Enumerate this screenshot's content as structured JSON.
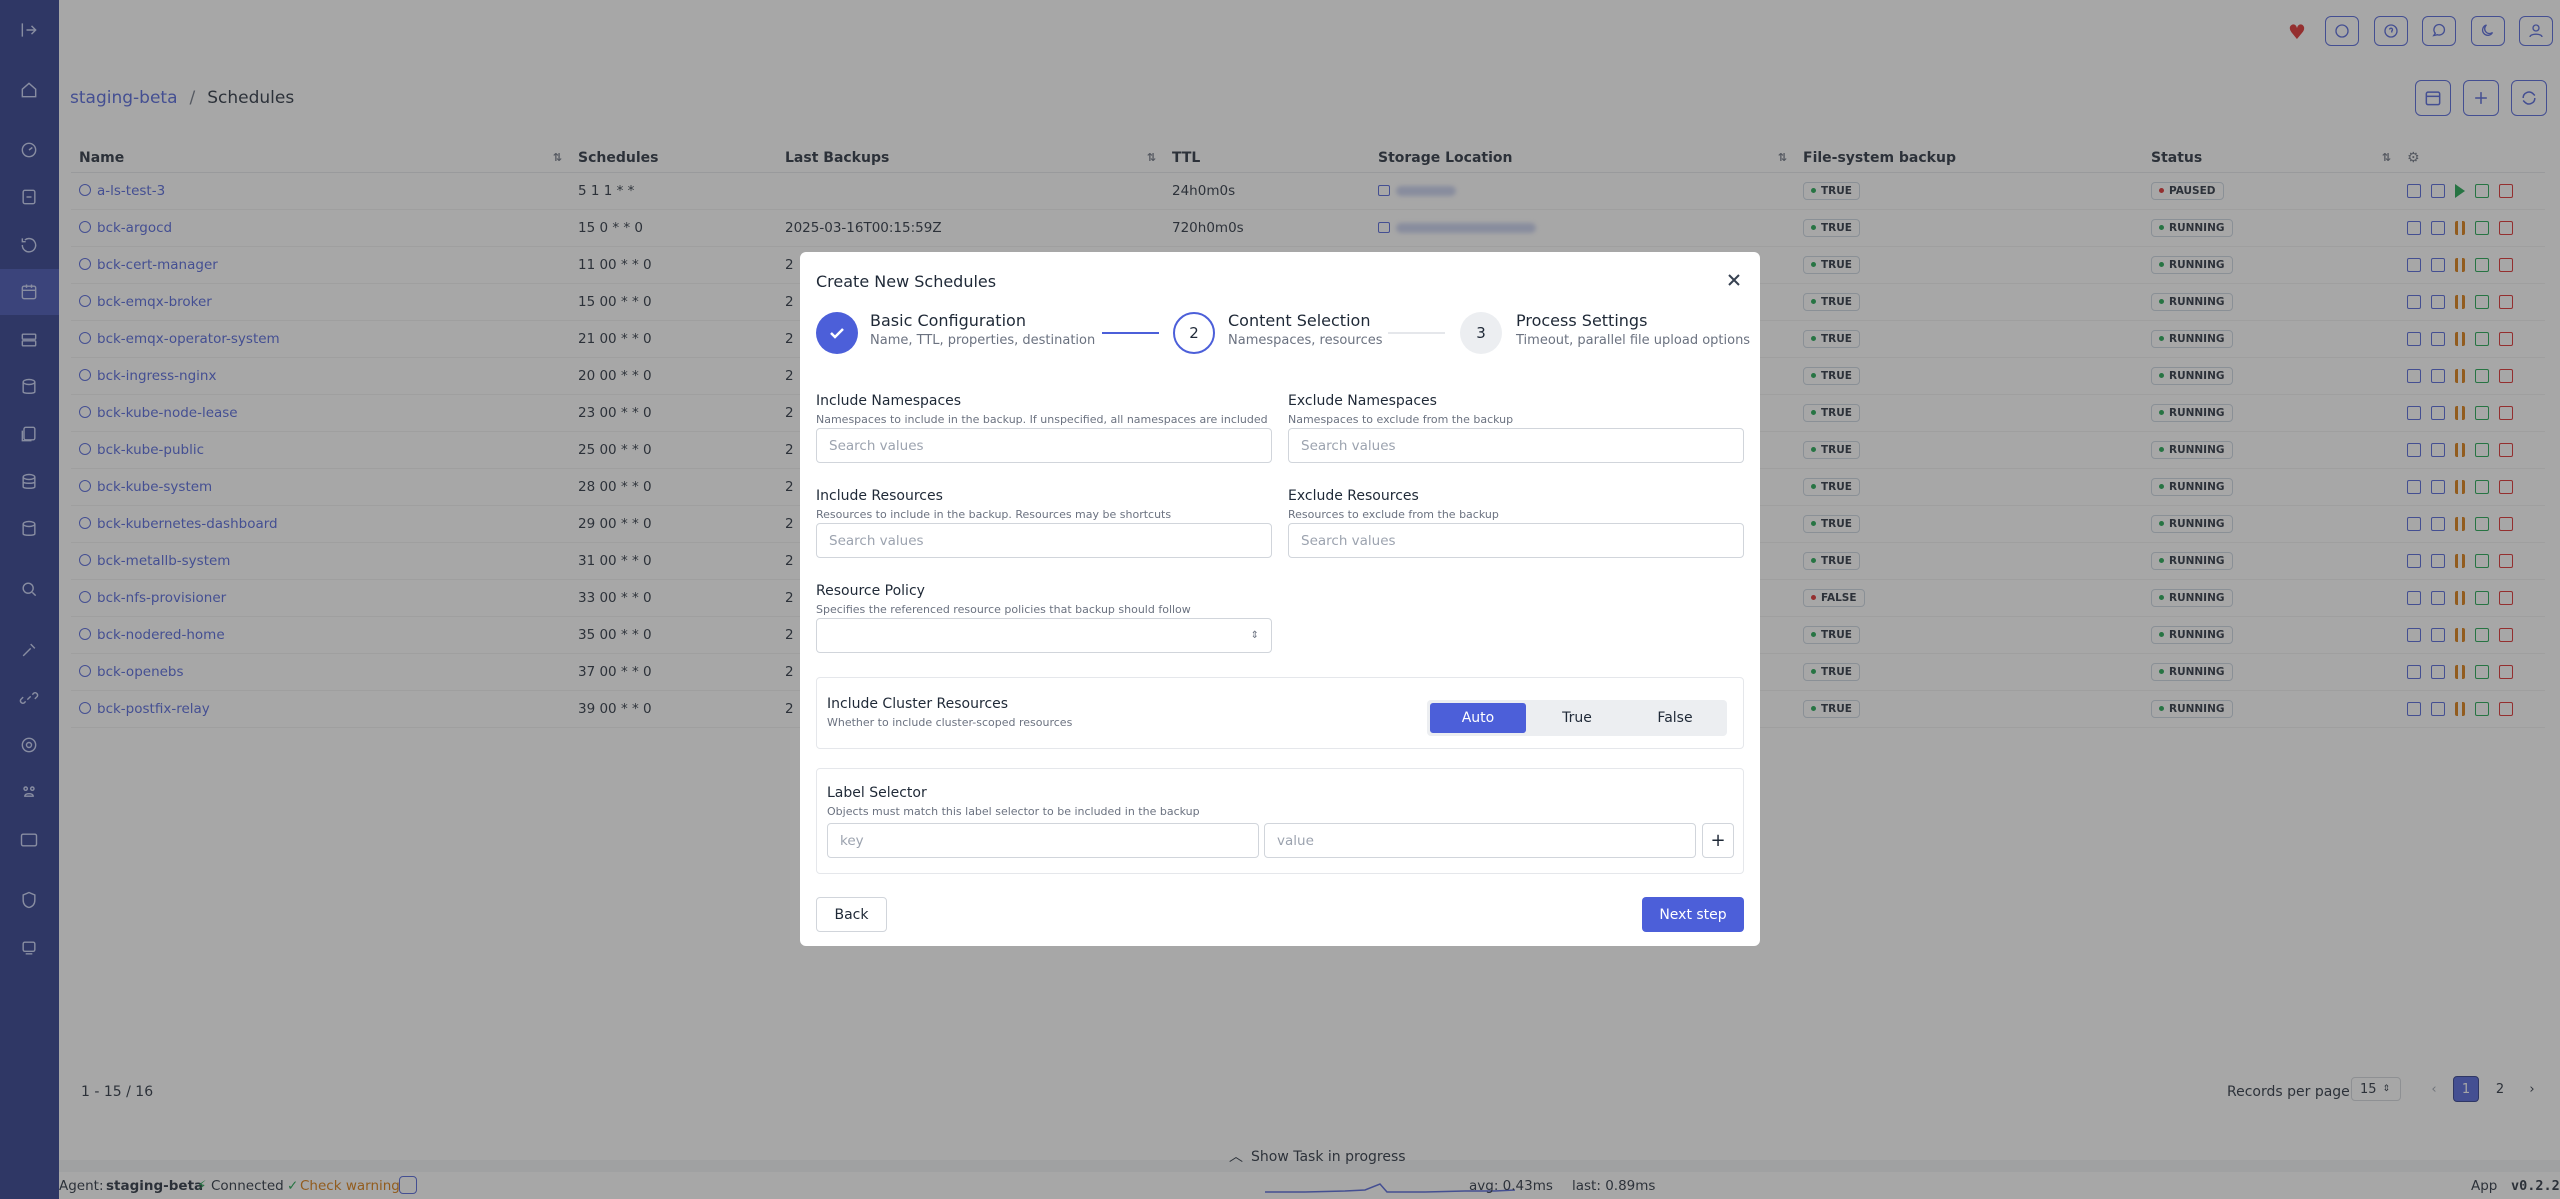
{
  "breadcrumb": {
    "cluster": "staging-beta",
    "separator": "/",
    "page": "Schedules"
  },
  "table": {
    "columns": [
      "Name",
      "Schedules",
      "Last Backups",
      "TTL",
      "Storage Location",
      "File-system backup",
      "Status"
    ],
    "rows": [
      {
        "name": "a-ls-test-3",
        "schedule": "5 1 1 * *",
        "last": "",
        "ttl": "24h0m0s",
        "fs": "TRUE",
        "status": "PAUSED"
      },
      {
        "name": "bck-argocd",
        "schedule": "15 0 * * 0",
        "last": "2025-03-16T00:15:59Z",
        "ttl": "720h0m0s",
        "fs": "TRUE",
        "status": "RUNNING"
      },
      {
        "name": "bck-cert-manager",
        "schedule": "11 00 * * 0",
        "last": "2",
        "ttl": "",
        "fs": "TRUE",
        "status": "RUNNING"
      },
      {
        "name": "bck-emqx-broker",
        "schedule": "15 00 * * 0",
        "last": "2",
        "ttl": "",
        "fs": "TRUE",
        "status": "RUNNING"
      },
      {
        "name": "bck-emqx-operator-system",
        "schedule": "21 00 * * 0",
        "last": "2",
        "ttl": "",
        "fs": "TRUE",
        "status": "RUNNING"
      },
      {
        "name": "bck-ingress-nginx",
        "schedule": "20 00 * * 0",
        "last": "2",
        "ttl": "",
        "fs": "TRUE",
        "status": "RUNNING"
      },
      {
        "name": "bck-kube-node-lease",
        "schedule": "23 00 * * 0",
        "last": "2",
        "ttl": "",
        "fs": "TRUE",
        "status": "RUNNING"
      },
      {
        "name": "bck-kube-public",
        "schedule": "25 00 * * 0",
        "last": "2",
        "ttl": "",
        "fs": "TRUE",
        "status": "RUNNING"
      },
      {
        "name": "bck-kube-system",
        "schedule": "28 00 * * 0",
        "last": "2",
        "ttl": "",
        "fs": "TRUE",
        "status": "RUNNING"
      },
      {
        "name": "bck-kubernetes-dashboard",
        "schedule": "29 00 * * 0",
        "last": "2",
        "ttl": "",
        "fs": "TRUE",
        "status": "RUNNING"
      },
      {
        "name": "bck-metallb-system",
        "schedule": "31 00 * * 0",
        "last": "2",
        "ttl": "",
        "fs": "TRUE",
        "status": "RUNNING"
      },
      {
        "name": "bck-nfs-provisioner",
        "schedule": "33 00 * * 0",
        "last": "2",
        "ttl": "",
        "fs": "FALSE",
        "status": "RUNNING"
      },
      {
        "name": "bck-nodered-home",
        "schedule": "35 00 * * 0",
        "last": "2",
        "ttl": "",
        "fs": "TRUE",
        "status": "RUNNING"
      },
      {
        "name": "bck-openebs",
        "schedule": "37 00 * * 0",
        "last": "2",
        "ttl": "",
        "fs": "TRUE",
        "status": "RUNNING"
      },
      {
        "name": "bck-postfix-relay",
        "schedule": "39 00 * * 0",
        "last": "2",
        "ttl": "",
        "fs": "TRUE",
        "status": "RUNNING"
      }
    ]
  },
  "footer": {
    "range": "1 - 15 / 16",
    "records_label": "Records per page",
    "records_value": "15",
    "pages": [
      "1",
      "2"
    ],
    "current_page": "1",
    "show_task": "Show Task in progress"
  },
  "statusbar": {
    "agent_label": "Agent:",
    "agent_name": "staging-beta",
    "connected": "Connected",
    "warning": "Check warning",
    "avg": "avg: 0.43ms",
    "last": "last: 0.89ms",
    "app": "App",
    "version": "v0.2.2"
  },
  "modal": {
    "title": "Create New Schedules",
    "steps": [
      {
        "number": "1",
        "title": "Basic Configuration",
        "subtitle": "Name, TTL, properties, destination"
      },
      {
        "number": "2",
        "title": "Content Selection",
        "subtitle": "Namespaces, resources"
      },
      {
        "number": "3",
        "title": "Process Settings",
        "subtitle": "Timeout, parallel file upload options"
      }
    ],
    "include_ns": {
      "label": "Include Namespaces",
      "help": "Namespaces to include in the backup. If unspecified, all namespaces are included",
      "placeholder": "Search values"
    },
    "exclude_ns": {
      "label": "Exclude Namespaces",
      "help": "Namespaces to exclude from the backup",
      "placeholder": "Search values"
    },
    "include_res": {
      "label": "Include Resources",
      "help": "Resources to include in the backup. Resources may be shortcuts",
      "placeholder": "Search values"
    },
    "exclude_res": {
      "label": "Exclude Resources",
      "help": "Resources to exclude from the backup",
      "placeholder": "Search values"
    },
    "policy": {
      "label": "Resource Policy",
      "help": "Specifies the referenced resource policies that backup should follow"
    },
    "cluster": {
      "label": "Include Cluster Resources",
      "help": "Whether to include cluster-scoped resources",
      "options": [
        "Auto",
        "True",
        "False"
      ],
      "selected": "Auto"
    },
    "label_selector": {
      "label": "Label Selector",
      "help": "Objects must match this label selector to be included in the backup",
      "key_placeholder": "key",
      "value_placeholder": "value"
    },
    "back": "Back",
    "next": "Next step"
  },
  "colors": {
    "accent": "#4c5fd9",
    "sidebar": "#253487",
    "paused": "#dc2626",
    "running": "#16a34a",
    "heart": "#dc2626"
  }
}
